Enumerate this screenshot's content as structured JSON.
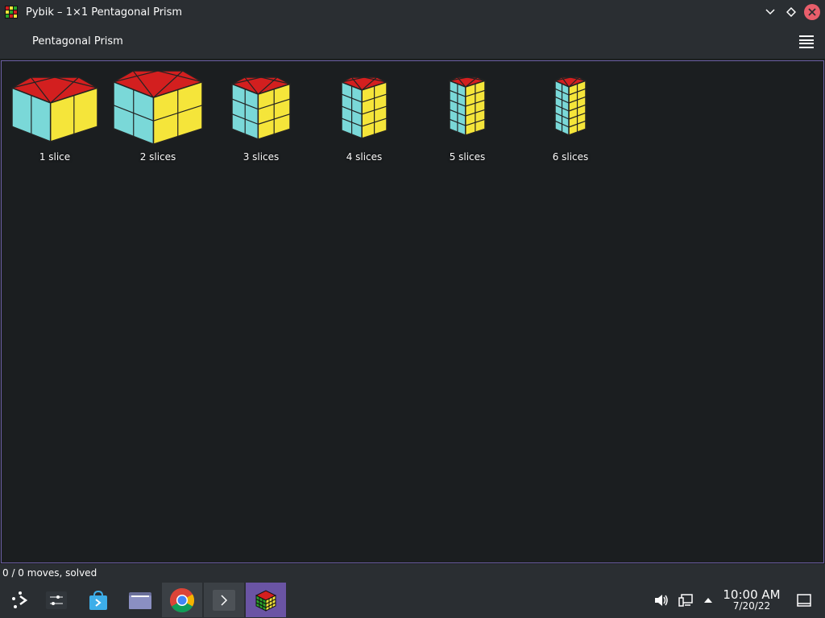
{
  "window": {
    "title": "Pybik – 1×1 Pentagonal Prism",
    "minimize_icon": "chevron-down-icon",
    "maximize_icon": "diamond-icon",
    "close_icon": "close-icon"
  },
  "toolbar": {
    "title": "Pentagonal Prism",
    "menu_icon": "hamburger-menu-icon"
  },
  "puzzles": [
    {
      "label": "1 slice",
      "slices": 1
    },
    {
      "label": "2 slices",
      "slices": 2
    },
    {
      "label": "3 slices",
      "slices": 3
    },
    {
      "label": "4 slices",
      "slices": 4
    },
    {
      "label": "5 slices",
      "slices": 5
    },
    {
      "label": "6 slices",
      "slices": 6
    }
  ],
  "status": {
    "text": "0 / 0 moves, solved"
  },
  "taskbar": {
    "items": [
      {
        "name": "application-launcher-icon"
      },
      {
        "name": "system-settings-icon"
      },
      {
        "name": "discover-store-icon"
      },
      {
        "name": "file-manager-icon"
      },
      {
        "name": "chrome-icon"
      },
      {
        "name": "terminal-icon"
      },
      {
        "name": "pybik-icon"
      }
    ],
    "tray": {
      "volume_icon": "volume-icon",
      "network_icon": "network-icon",
      "expand_icon": "chevron-up-icon",
      "show_desktop_icon": "show-desktop-icon"
    },
    "clock": {
      "time": "10:00 AM",
      "date": "7/20/22"
    }
  },
  "colors": {
    "top": "#d31f1f",
    "left": "#7ad8d8",
    "right": "#f5e53a",
    "accent": "#6a54a4"
  }
}
